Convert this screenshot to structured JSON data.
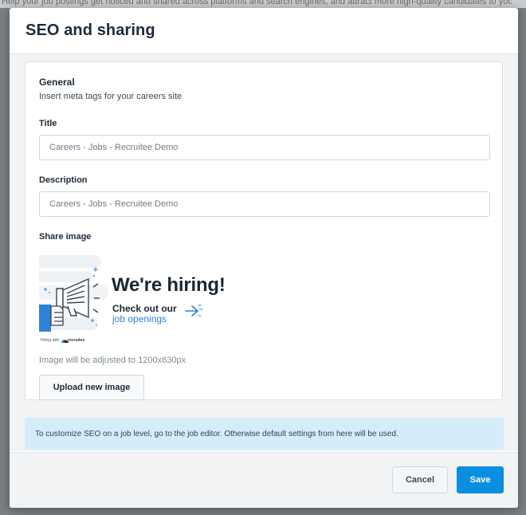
{
  "backdrop": {
    "top_text": "Help your job postings get noticed and shared across platforms and search engines, and attract more high-quality candidates to your career site."
  },
  "modal": {
    "title": "SEO and sharing"
  },
  "general": {
    "heading": "General",
    "subtitle": "Insert meta tags for your careers site"
  },
  "fields": {
    "title_label": "Title",
    "title_placeholder": "Careers - Jobs - Recruitee Demo",
    "description_label": "Description",
    "description_placeholder": "Careers - Jobs - Recruitee Demo"
  },
  "share_image": {
    "label": "Share image",
    "headline": "We're hiring!",
    "line1": "Check out our",
    "line2": "job openings",
    "hiring_with": "Hiring with",
    "brand": "recruitee",
    "note": "Image will be adjusted to 1200x630px",
    "upload_label": "Upload new image"
  },
  "info_banner": {
    "text": "To customize SEO on a job level, go to the job editor. Otherwise default settings from here will be used."
  },
  "footer": {
    "cancel_label": "Cancel",
    "save_label": "Save"
  },
  "colors": {
    "primary": "#0a8fe0",
    "banner_bg": "#d5ecfa",
    "accent_blue": "#2f82d6",
    "text_dark": "#1c2b38"
  },
  "icons": {
    "megaphone": "megaphone-icon",
    "arrow": "arrow-right-icon",
    "brand_logo": "recruitee-logo-icon"
  }
}
